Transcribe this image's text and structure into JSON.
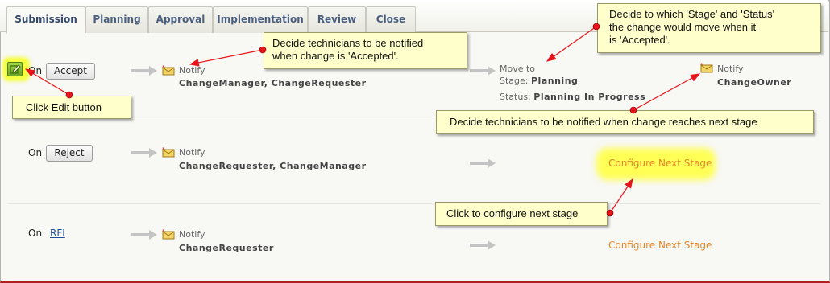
{
  "tabs": [
    {
      "label": "Submission",
      "active": true
    },
    {
      "label": "Planning",
      "active": false
    },
    {
      "label": "Approval",
      "active": false
    },
    {
      "label": "Implementation",
      "active": false
    },
    {
      "label": "Review",
      "active": false
    },
    {
      "label": "Close",
      "active": false
    }
  ],
  "rows": {
    "accept": {
      "on_label": "On",
      "button_label": "Accept",
      "notify_label": "Notify",
      "notify_who": "ChangeManager, ChangeRequester",
      "move_to_label": "Move to",
      "stage_label": "Stage:",
      "stage_value": "Planning",
      "status_label": "Status:",
      "status_value": "Planning In Progress",
      "next_notify_label": "Notify",
      "next_notify_who": "ChangeOwner"
    },
    "reject": {
      "on_label": "On",
      "button_label": "Reject",
      "notify_label": "Notify",
      "notify_who": "ChangeRequester, ChangeManager",
      "configure_label": "Configure Next Stage"
    },
    "rfi": {
      "on_label": "On",
      "link_label": "RFI",
      "notify_label": "Notify",
      "notify_who": "ChangeRequester",
      "configure_label": "Configure Next Stage"
    }
  },
  "callouts": {
    "notify_accepted_line1": "Decide technicians to be notified",
    "notify_accepted_line2": "when change is  'Accepted'.",
    "stage_status_line1": "Decide to which 'Stage' and 'Status'",
    "stage_status_line2": "the change would move when it",
    "stage_status_line3": "is 'Accepted'.",
    "edit_button": "Click Edit button",
    "next_stage_notify": "Decide technicians to be notified when change reaches next stage",
    "configure_next": "Click to configure next stage"
  },
  "colors": {
    "callout_bg": "#ffffcc",
    "callout_arrow": "#e8141b",
    "configure_link": "#e2862a",
    "tab_text": "#4a5f80"
  },
  "icons": {
    "edit": "edit-pencil-icon",
    "notify": "mail-envelope-icon",
    "flow_arrow": "gray-right-arrow-icon"
  }
}
